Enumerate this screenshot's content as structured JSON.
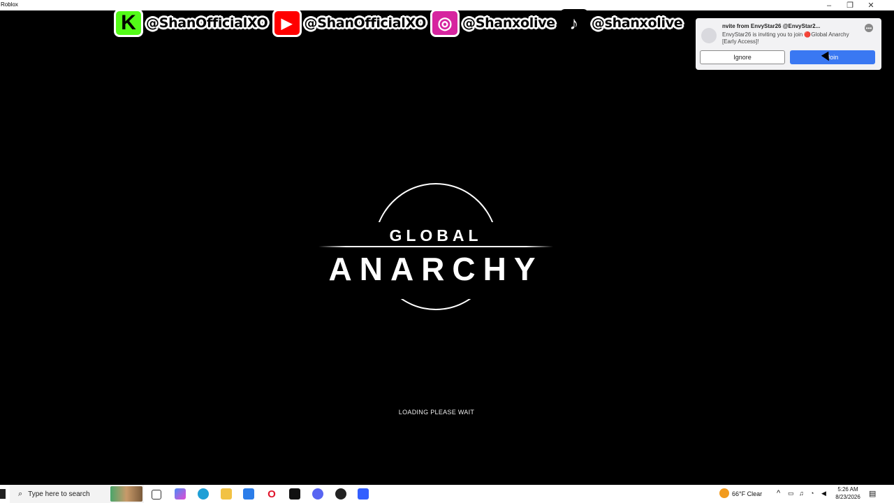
{
  "window": {
    "title": "Roblox",
    "controls": [
      "–",
      "❐",
      "✕"
    ]
  },
  "banner": [
    {
      "icon": "kick-icon",
      "glyph": "K",
      "bg": "#53fc18",
      "fg": "#000000",
      "handle": "@ShanOfficialXO"
    },
    {
      "icon": "youtube-icon",
      "glyph": "▶",
      "bg": "#ff0000",
      "fg": "#ffffff",
      "handle": "@ShanOfficialXO"
    },
    {
      "icon": "instagram-icon",
      "glyph": "◎",
      "bg": "#d6249f",
      "fg": "#ffffff",
      "handle": "@Shanxolive"
    },
    {
      "icon": "tiktok-icon",
      "glyph": "♪",
      "bg": "#000000",
      "fg": "#ffffff",
      "handle": "@shanxolive"
    }
  ],
  "invite": {
    "heading": "nvite from EnvyStar26 @EnvyStar2...",
    "body": "EnvyStar26 is inviting you to join 🔴Global Anarchy [Early Access]!",
    "ignore_label": "Ignore",
    "join_label": "Join"
  },
  "logo": {
    "line1": "GLOBAL",
    "line2": "ANARCHY"
  },
  "loading_text": "LOADING PLEASE WAIT",
  "taskbar": {
    "search_placeholder": "Type here to search",
    "weather": "66°F  Clear",
    "time": "5:26 AM",
    "date": "8/23/2026"
  },
  "colors": {
    "accent": "#3a78f2",
    "background": "#000000"
  }
}
